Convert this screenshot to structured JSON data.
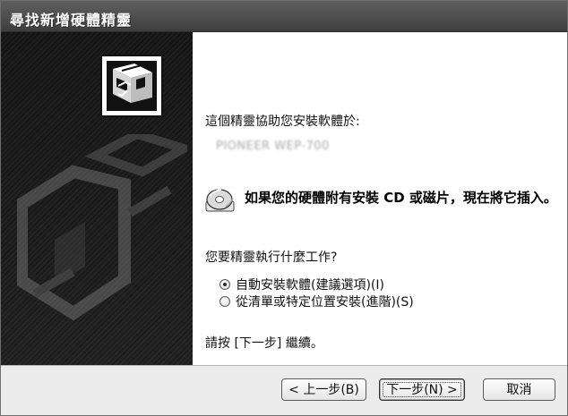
{
  "window": {
    "title": "尋找新增硬體精靈"
  },
  "content": {
    "intro": "這個精靈協助您安裝軟體於:",
    "device_name": "PIONEER WEP-700",
    "insert_prompt": "如果您的硬體附有安裝 CD 或磁片，現在將它插入。",
    "question": "您要精靈執行什麼工作?",
    "options": [
      {
        "label": "自動安裝軟體(建議選項)(I)",
        "selected": true
      },
      {
        "label": "從清單或特定位置安裝(進階)(S)",
        "selected": false
      }
    ],
    "continue_hint": "請按 [下一步] 繼續。"
  },
  "buttons": {
    "back": "< 上一步(B)",
    "next": "下一步(N) >",
    "cancel": "取消"
  },
  "icons": {
    "hardware": "hardware-wizard-icon",
    "cd": "cd-disc-icon",
    "decor": "hardware-silhouette-icon"
  },
  "colors": {
    "titlebar": "#4a4a4a",
    "left_panel": "#1b1b1b",
    "content_background": "#ffffff",
    "footer": "#ececec"
  }
}
